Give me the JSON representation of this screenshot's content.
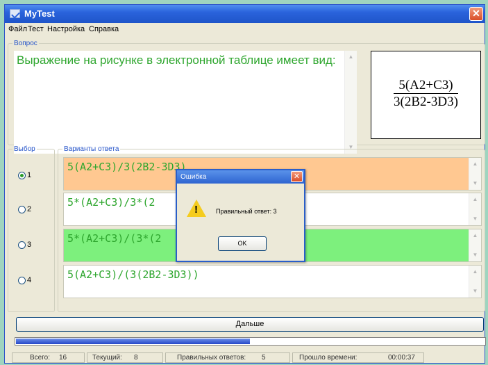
{
  "window": {
    "title": "MyTest"
  },
  "menu": [
    "Файл",
    "Тест",
    "Настройка",
    "Справка"
  ],
  "question": {
    "legend": "Вопрос",
    "text": "Выражение на рисунке в электронной таблице имеет вид:",
    "formula_numerator": "5(A2+C3)",
    "formula_denominator": "3(2B2-3D3)"
  },
  "choice_legend": "Выбор",
  "answers_legend": "Варианты ответа",
  "answers": [
    {
      "num": "1",
      "text": "5(A2+C3)/3(2B2-3D3)",
      "bg": "#ffc891",
      "selected": true
    },
    {
      "num": "2",
      "text": "5*(A2+C3)/3*(2",
      "bg": "#ffffff",
      "selected": false
    },
    {
      "num": "3",
      "text": "5*(A2+C3)/(3*(2",
      "bg": "#7df07d",
      "selected": false
    },
    {
      "num": "4",
      "text": "5(A2+C3)/(3(2B2-3D3))",
      "bg": "#ffffff",
      "selected": false
    }
  ],
  "next_label": "Дальше",
  "progress": 0.5,
  "status": {
    "total_label": "Всего:",
    "total_value": "16",
    "current_label": "Текущий:",
    "current_value": "8",
    "correct_label": "Правильных ответов:",
    "correct_value": "5",
    "elapsed_label": "Прошло времени:",
    "elapsed_value": "00:00:37"
  },
  "dialog": {
    "title": "Ошибка",
    "message": "Правильный ответ: 3",
    "ok_label": "OK"
  },
  "colors": {
    "title_bar": "#2a63dc",
    "text_green": "#2ea62e",
    "answer_selected": "#ffc891",
    "answer_correct": "#7df07d"
  }
}
